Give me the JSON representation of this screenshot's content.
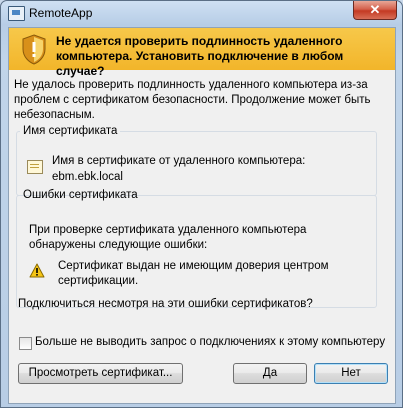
{
  "window": {
    "title": "RemoteApp",
    "close_glyph": "✕"
  },
  "banner": {
    "text": "Не удается проверить подлинность удаленного компьютера. Установить подключение в любом случае?",
    "icon": "shield-warning-icon"
  },
  "intro": "Не удалось проверить подлинность удаленного компьютера из-за проблем с сертификатом безопасности. Продолжение может быть небезопасным.",
  "certificate_group": {
    "legend": "Имя сертификата",
    "label": "Имя в сертификате от удаленного компьютера:",
    "value": "ebm.ebk.local",
    "icon": "certificate-icon"
  },
  "errors_group": {
    "legend": "Ошибки сертификата",
    "intro": "При проверке сертификата удаленного компьютера обнаружены следующие ошибки:",
    "items": [
      {
        "icon": "warning-icon",
        "text": "Сертификат выдан не имеющим доверия центром сертификации."
      }
    ]
  },
  "question": "Подключиться несмотря на эти ошибки сертификатов?",
  "dont_ask_checkbox": {
    "label": "Больше не выводить запрос о подключениях к этому компьютеру",
    "checked": false
  },
  "buttons": {
    "view_certificate": "Просмотреть сертификат...",
    "yes": "Да",
    "no": "Нет"
  },
  "colors": {
    "banner": "#f5c13e",
    "client_bg": "#f0f0f0",
    "close_button": "#c43a23",
    "default_button_border": "#3c7fb1"
  }
}
